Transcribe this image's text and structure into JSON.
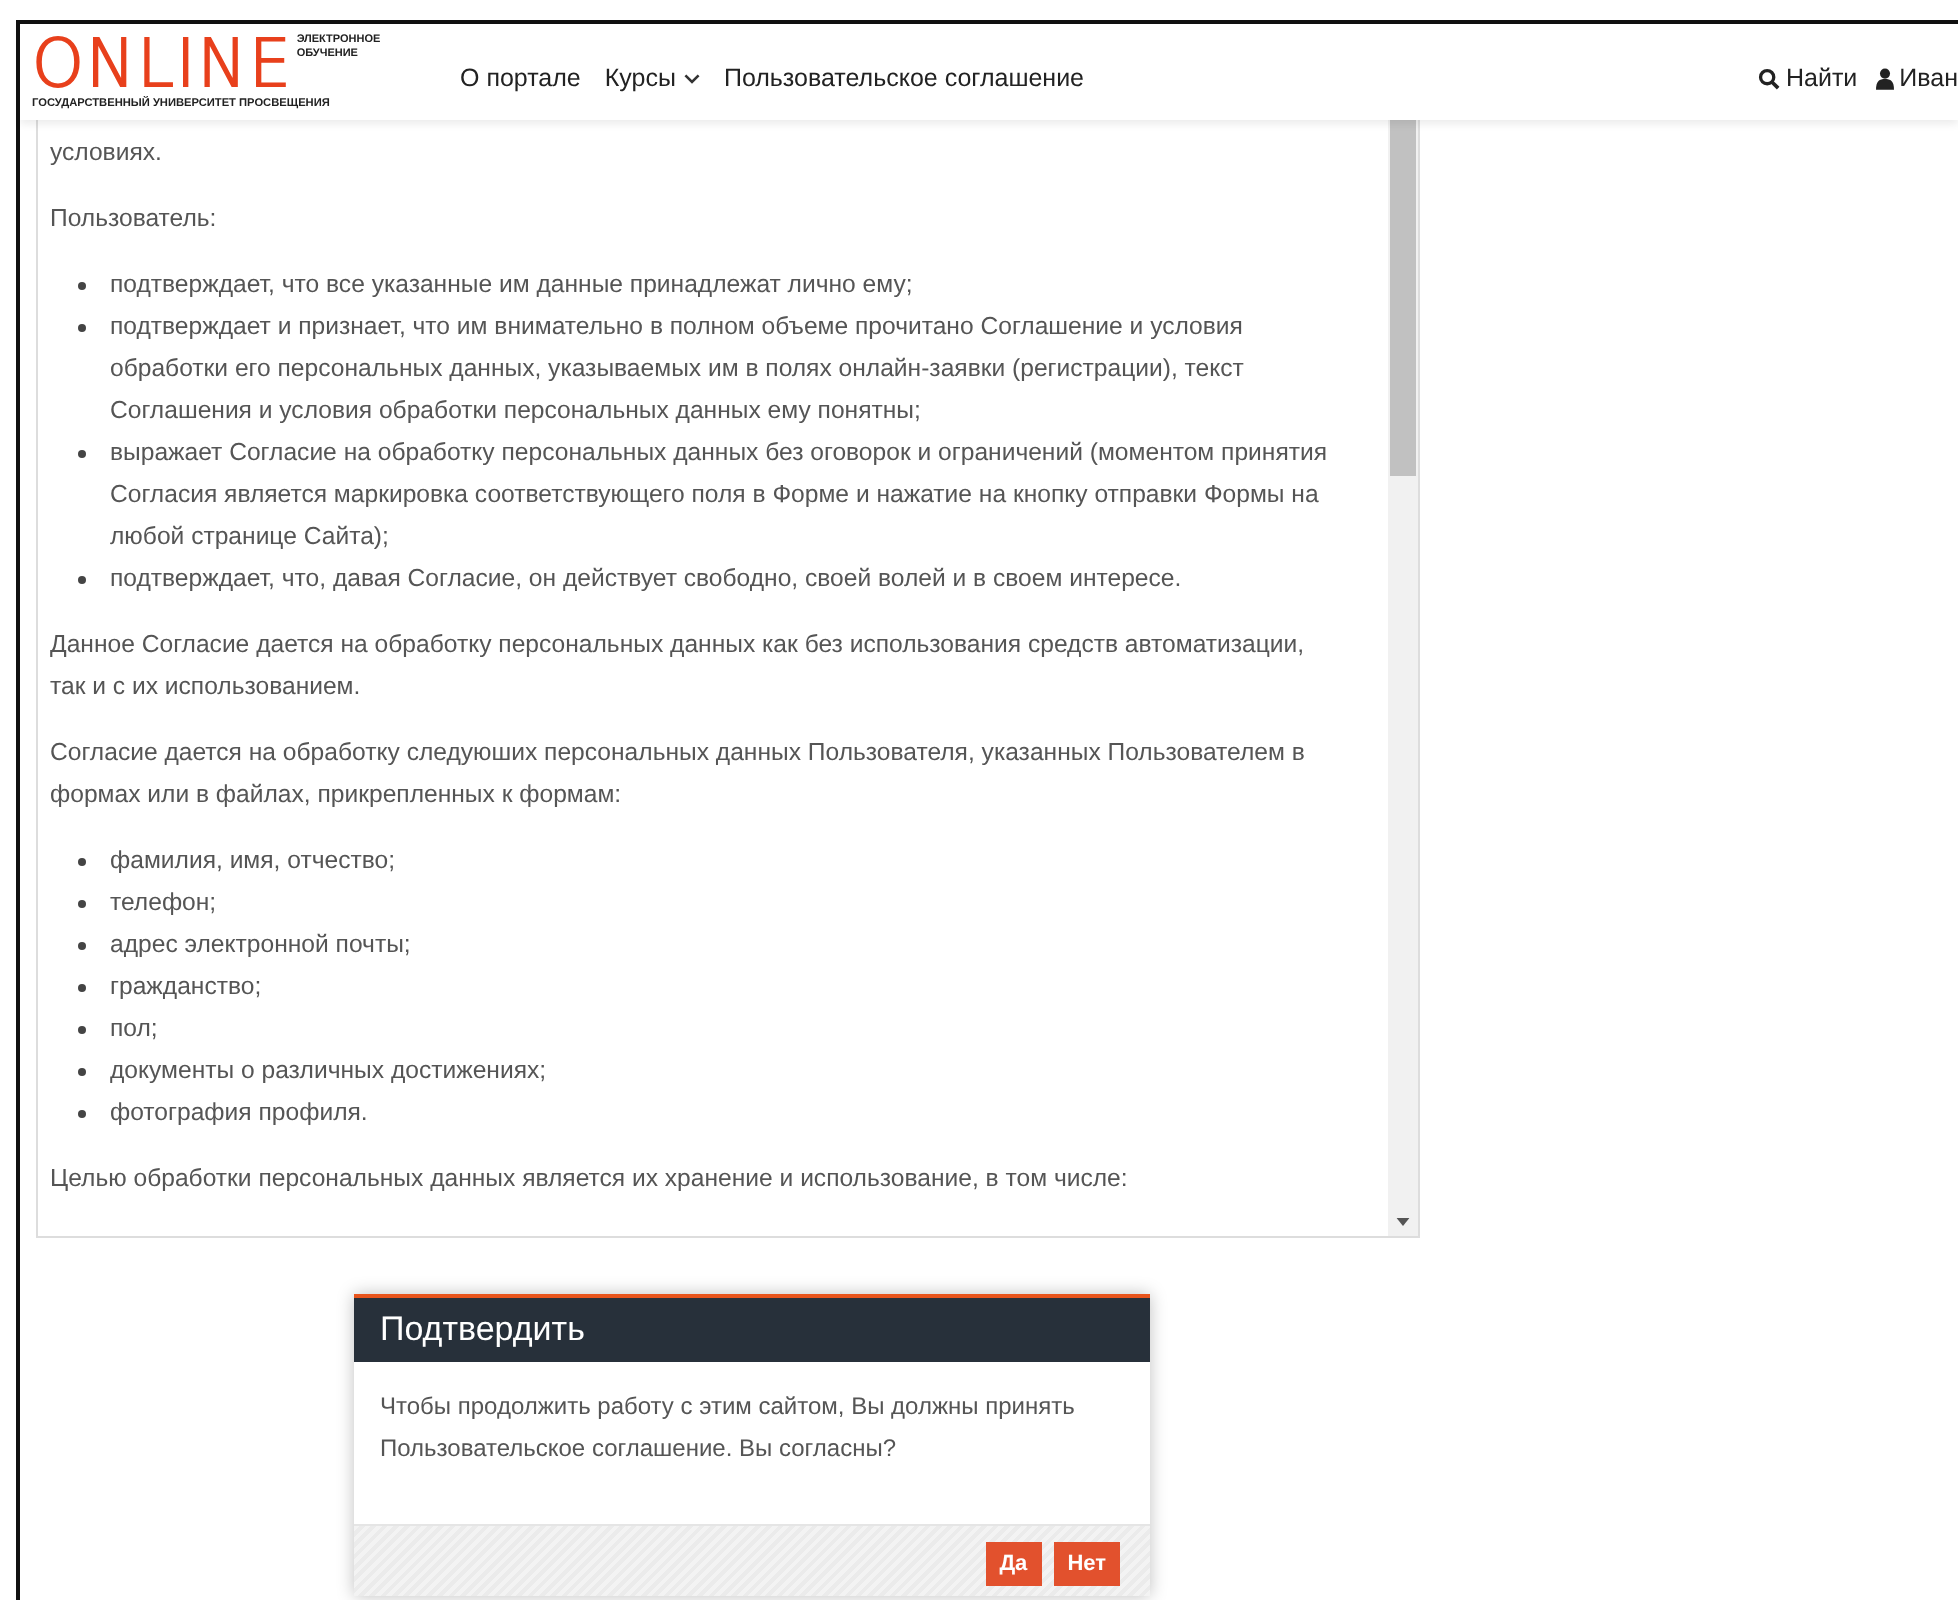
{
  "header": {
    "logo": {
      "wordmark": "ONLINE",
      "tagline_top": "ЭЛЕКТРОННОЕ",
      "tagline_bottom": "ОБУЧЕНИЕ",
      "university": "ГОСУДАРСТВЕННЫЙ УНИВЕРСИТЕТ ПРОСВЕЩЕНИЯ"
    },
    "nav": [
      {
        "label": "О портале",
        "kind": "link"
      },
      {
        "label": "Курсы",
        "kind": "dropdown"
      },
      {
        "label": "Пользовательское соглашение",
        "kind": "link"
      }
    ],
    "search": {
      "label": "Найти"
    },
    "user": {
      "label": "Иван"
    }
  },
  "document": {
    "blocks": [
      {
        "kind": "paragraph",
        "text": "условиях."
      },
      {
        "kind": "paragraph",
        "text": "Пользователь:"
      },
      {
        "kind": "list",
        "items": [
          "подтверждает, что все указанные им данные принадлежат лично ему;",
          "подтверждает и признает, что им внимательно в полном объеме прочитано Соглашение и условия обработки его персональных данных, указываемых им в полях онлайн-заявки (регистрации), текст Соглашения и условия обработки персональных данных ему понятны;",
          "выражает Согласие на обработку персональных данных без оговорок и ограничений (моментом принятия Согласия является маркировка соответствующего поля в Форме и нажатие на кнопку отправки Формы на любой странице Сайта);",
          "подтверждает, что, давая Согласие, он действует свободно, своей волей и в своем интересе."
        ]
      },
      {
        "kind": "paragraph",
        "text": "Данное Согласие дается на обработку персональных данных как без использования средств автоматизации, так и с их использованием."
      },
      {
        "kind": "paragraph",
        "text": "Согласие дается на обработку следуюших персональных данных Пользователя, указанных Пользователем в формах или в файлах, прикрепленных к формам:"
      },
      {
        "kind": "list",
        "items": [
          "фамилия, имя, отчество;",
          "телефон;",
          "адрес электронной почты;",
          "гражданство;",
          "пол;",
          "документы о различных достижениях;",
          "фотография профиля."
        ]
      },
      {
        "kind": "paragraph",
        "text": "Целью обработки персональных данных является их хранение и использование, в том числе:"
      }
    ]
  },
  "dialog": {
    "title": "Подтвердить",
    "message": "Чтобы продолжить работу с этим сайтом, Вы должны принять Пользовательское соглашение. Вы согласны?",
    "buttons": [
      "Да",
      "Нет"
    ]
  }
}
